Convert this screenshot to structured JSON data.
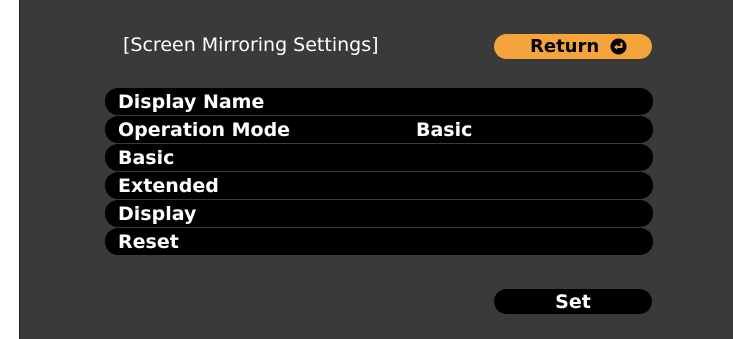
{
  "header": {
    "title": "[Screen Mirroring Settings]",
    "return_label": "Return",
    "return_icon": "enter-icon"
  },
  "menu": {
    "items": [
      {
        "label": "Display Name",
        "value": ""
      },
      {
        "label": "Operation Mode",
        "value": "Basic"
      },
      {
        "label": "Basic",
        "value": ""
      },
      {
        "label": "Extended",
        "value": ""
      },
      {
        "label": "Display",
        "value": ""
      },
      {
        "label": "Reset",
        "value": ""
      }
    ]
  },
  "footer": {
    "set_label": "Set"
  },
  "colors": {
    "panel_background": "#3a3a3a",
    "item_background": "#000000",
    "return_button": "#f4a43a",
    "text": "#ffffff"
  }
}
